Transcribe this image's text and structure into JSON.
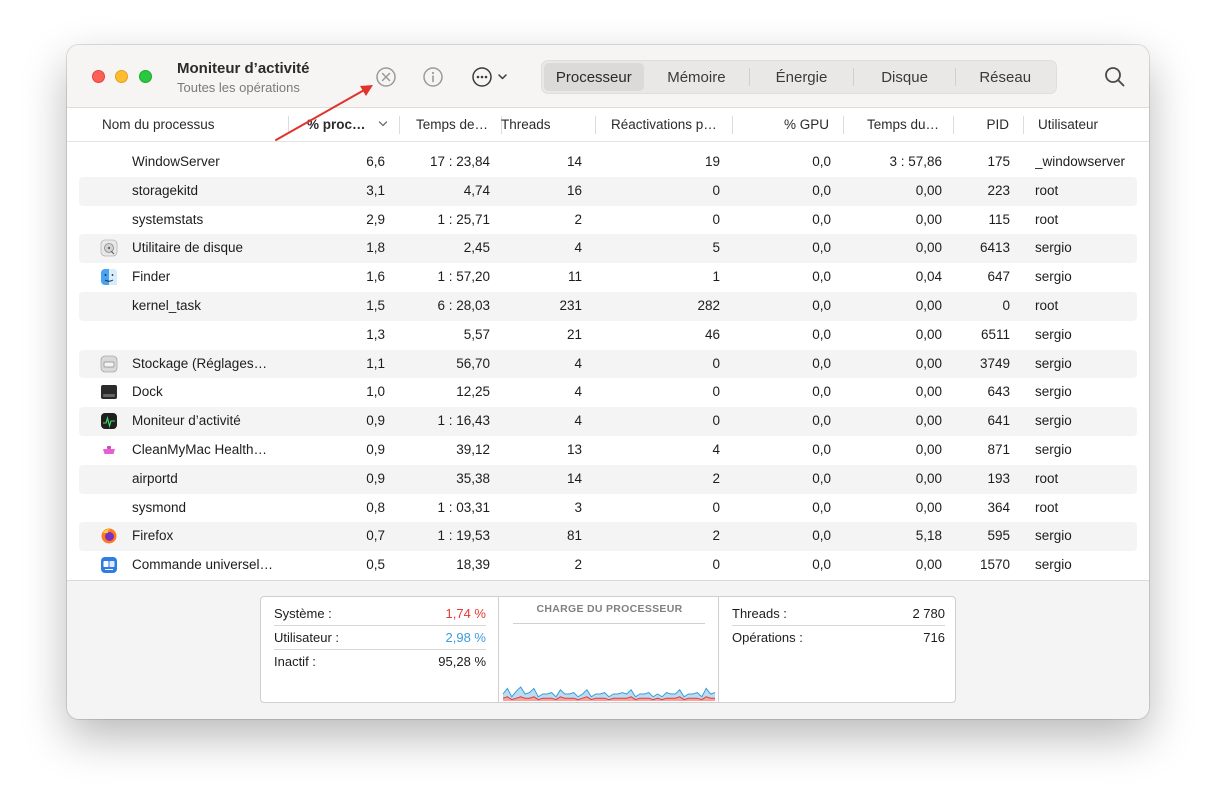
{
  "window": {
    "title": "Moniteur d’activité",
    "subtitle": "Toutes les opérations"
  },
  "toolbar": {
    "icons": [
      "stop-process-icon",
      "info-icon",
      "more-icon",
      "chevron-down-icon",
      "search-icon"
    ],
    "tabs": [
      {
        "label": "Processeur",
        "active": true
      },
      {
        "label": "Mémoire",
        "active": false
      },
      {
        "label": "Énergie",
        "active": false
      },
      {
        "label": "Disque",
        "active": false
      },
      {
        "label": "Réseau",
        "active": false
      }
    ]
  },
  "table": {
    "columns": [
      "Nom du processus",
      "% proc…",
      "Temps de…",
      "Threads",
      "Réactivations p…",
      "% GPU",
      "Temps du…",
      "PID",
      "Utilisateur"
    ],
    "rows": [
      {
        "icon": "",
        "name": "WindowServer",
        "cpu": "6,6",
        "time": "17 : 23,84",
        "threads": "14",
        "wakeups": "19",
        "gpu": "0,0",
        "gputime": "3 : 57,86",
        "pid": "175",
        "user": "_windowserver"
      },
      {
        "icon": "",
        "name": "storagekitd",
        "cpu": "3,1",
        "time": "4,74",
        "threads": "16",
        "wakeups": "0",
        "gpu": "0,0",
        "gputime": "0,00",
        "pid": "223",
        "user": "root"
      },
      {
        "icon": "",
        "name": "systemstats",
        "cpu": "2,9",
        "time": "1 : 25,71",
        "threads": "2",
        "wakeups": "0",
        "gpu": "0,0",
        "gputime": "0,00",
        "pid": "115",
        "user": "root"
      },
      {
        "icon": "disk-utility-icon",
        "name": "Utilitaire de disque",
        "cpu": "1,8",
        "time": "2,45",
        "threads": "4",
        "wakeups": "5",
        "gpu": "0,0",
        "gputime": "0,00",
        "pid": "6413",
        "user": "sergio"
      },
      {
        "icon": "finder-icon",
        "name": "Finder",
        "cpu": "1,6",
        "time": "1 : 57,20",
        "threads": "11",
        "wakeups": "1",
        "gpu": "0,0",
        "gputime": "0,04",
        "pid": "647",
        "user": "sergio"
      },
      {
        "icon": "",
        "name": "kernel_task",
        "cpu": "1,5",
        "time": "6 : 28,03",
        "threads": "231",
        "wakeups": "282",
        "gpu": "0,0",
        "gputime": "0,00",
        "pid": "0",
        "user": "root"
      },
      {
        "icon": "",
        "name": "",
        "cpu": "1,3",
        "time": "5,57",
        "threads": "21",
        "wakeups": "46",
        "gpu": "0,0",
        "gputime": "0,00",
        "pid": "6511",
        "user": "sergio"
      },
      {
        "icon": "storage-settings-icon",
        "name": "Stockage (Réglages…",
        "cpu": "1,1",
        "time": "56,70",
        "threads": "4",
        "wakeups": "0",
        "gpu": "0,0",
        "gputime": "0,00",
        "pid": "3749",
        "user": "sergio"
      },
      {
        "icon": "dock-icon",
        "name": "Dock",
        "cpu": "1,0",
        "time": "12,25",
        "threads": "4",
        "wakeups": "0",
        "gpu": "0,0",
        "gputime": "0,00",
        "pid": "643",
        "user": "sergio"
      },
      {
        "icon": "activity-monitor-icon",
        "name": "Moniteur d’activité",
        "cpu": "0,9",
        "time": "1 : 16,43",
        "threads": "4",
        "wakeups": "0",
        "gpu": "0,0",
        "gputime": "0,00",
        "pid": "641",
        "user": "sergio"
      },
      {
        "icon": "cleanmymac-icon",
        "name": "CleanMyMac Health…",
        "cpu": "0,9",
        "time": "39,12",
        "threads": "13",
        "wakeups": "4",
        "gpu": "0,0",
        "gputime": "0,00",
        "pid": "871",
        "user": "sergio"
      },
      {
        "icon": "",
        "name": "airportd",
        "cpu": "0,9",
        "time": "35,38",
        "threads": "14",
        "wakeups": "2",
        "gpu": "0,0",
        "gputime": "0,00",
        "pid": "193",
        "user": "root"
      },
      {
        "icon": "",
        "name": "sysmond",
        "cpu": "0,8",
        "time": "1 : 03,31",
        "threads": "3",
        "wakeups": "0",
        "gpu": "0,0",
        "gputime": "0,00",
        "pid": "364",
        "user": "root"
      },
      {
        "icon": "firefox-icon",
        "name": "Firefox",
        "cpu": "0,7",
        "time": "1 : 19,53",
        "threads": "81",
        "wakeups": "2",
        "gpu": "0,0",
        "gputime": "5,18",
        "pid": "595",
        "user": "sergio"
      },
      {
        "icon": "universal-control-icon",
        "name": "Commande universel…",
        "cpu": "0,5",
        "time": "18,39",
        "threads": "2",
        "wakeups": "0",
        "gpu": "0,0",
        "gputime": "0,00",
        "pid": "1570",
        "user": "sergio"
      }
    ]
  },
  "stats": {
    "systeme_label": "Système :",
    "systeme_value": "1,74 %",
    "utilisateur_label": "Utilisateur :",
    "utilisateur_value": "2,98 %",
    "inactif_label": "Inactif :",
    "inactif_value": "95,28 %",
    "chart_title": "CHARGE DU PROCESSEUR",
    "threads_label": "Threads :",
    "threads_value": "2 780",
    "operations_label": "Opérations :",
    "operations_value": "716"
  },
  "colors": {
    "systeme": "#e23a32",
    "utilisateur": "#3a9ed8",
    "annotation_arrow": "#e0332b"
  },
  "chart_data": {
    "type": "area",
    "title": "CHARGE DU PROCESSEUR",
    "ylim": [
      0,
      100
    ],
    "series": [
      {
        "name": "Utilisateur",
        "values": [
          3,
          6,
          2,
          5,
          7,
          3,
          4,
          6,
          2,
          3,
          3,
          4,
          2,
          5,
          3,
          3,
          4,
          2,
          3,
          5,
          2,
          3,
          3,
          4,
          2,
          3,
          3,
          4,
          3,
          5,
          2,
          3,
          3,
          4,
          2,
          3,
          2,
          4,
          3,
          3,
          5,
          2,
          3,
          3,
          4,
          2,
          6,
          3,
          4
        ]
      },
      {
        "name": "Système",
        "values": [
          2,
          3,
          1,
          2,
          3,
          2,
          2,
          3,
          1,
          2,
          2,
          2,
          1,
          3,
          2,
          2,
          2,
          1,
          2,
          3,
          1,
          2,
          2,
          2,
          1,
          2,
          2,
          2,
          2,
          3,
          1,
          2,
          2,
          2,
          1,
          2,
          1,
          2,
          2,
          2,
          3,
          1,
          2,
          2,
          2,
          1,
          3,
          2,
          2
        ]
      }
    ]
  }
}
